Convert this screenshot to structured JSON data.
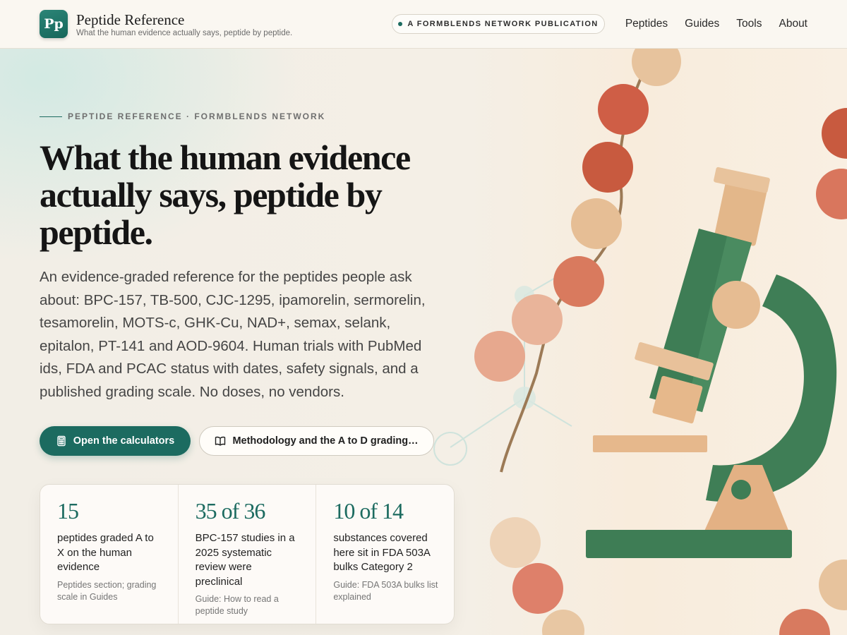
{
  "header": {
    "logo_text": "Pp",
    "title": "Peptide Reference",
    "tagline": "What the human evidence actually says, peptide by peptide.",
    "badge": "A FORMBLENDS NETWORK PUBLICATION",
    "nav": [
      "Peptides",
      "Guides",
      "Tools",
      "About"
    ]
  },
  "hero": {
    "eyebrow": "PEPTIDE REFERENCE · FORMBLENDS NETWORK",
    "title": "What the human evidence actually says, peptide by peptide.",
    "description": "An evidence-graded reference for the peptides people ask about: BPC-157, TB-500, CJC-1295, ipamorelin, sermorelin, tesamorelin, MOTS-c, GHK-Cu, NAD+, semax, selank, epitalon, PT-141 and AOD-9604. Human trials with PubMed ids, FDA and PCAC status with dates, safety signals, and a published grading scale. No doses, no vendors.",
    "primary_button": "Open the calculators",
    "secondary_button": "Methodology and the A to D grading…"
  },
  "stats": [
    {
      "value": "15",
      "label": "peptides graded A to X on the human evidence",
      "source": "Peptides section; grading scale in Guides"
    },
    {
      "value": "35 of 36",
      "label": "BPC-157 studies in a 2025 systematic review were preclinical",
      "source": "Guide: How to read a peptide study"
    },
    {
      "value": "10 of 14",
      "label": "substances covered here sit in FDA 503A bulks Category 2",
      "source": "Guide: FDA 503A bulks list explained"
    }
  ],
  "colors": {
    "accent": "#1c6b60",
    "background": "#f6f2ea"
  },
  "icons": {
    "primary_button": "calculator-icon",
    "secondary_button": "book-icon"
  }
}
